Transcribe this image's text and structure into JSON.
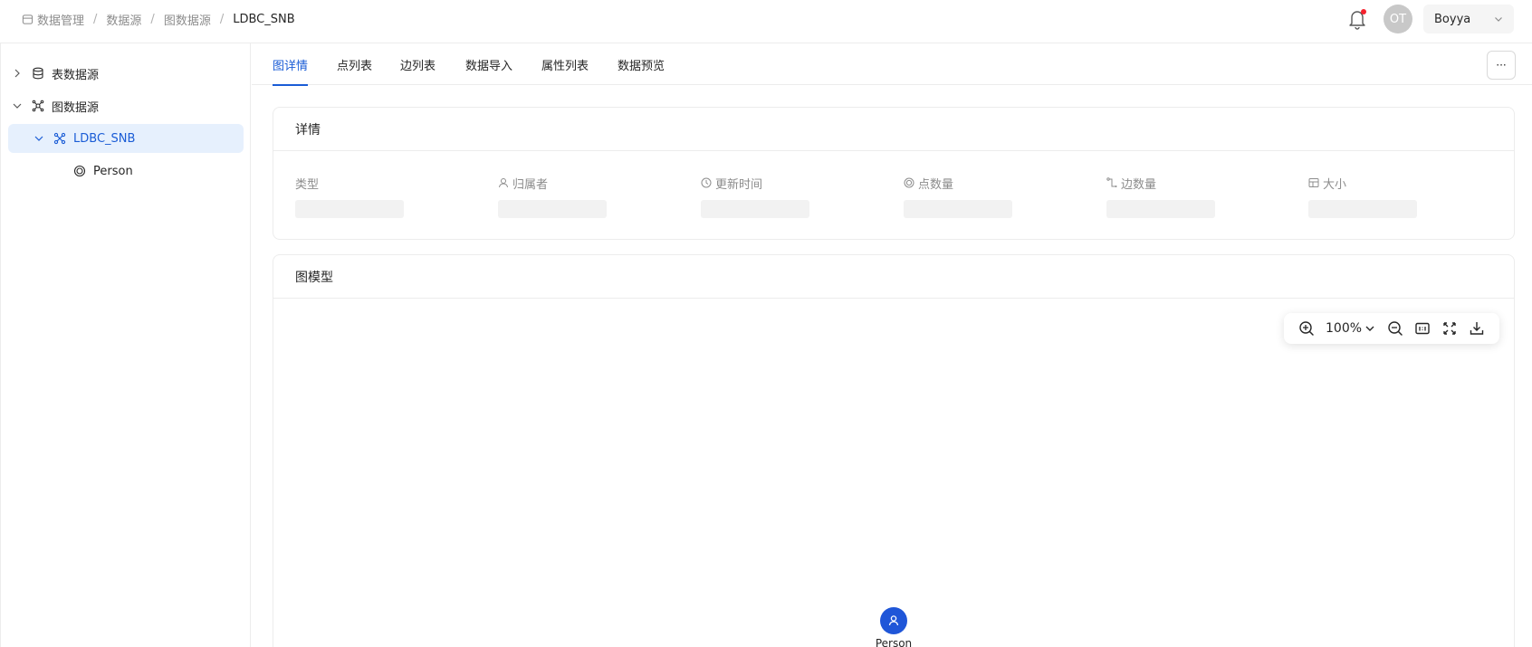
{
  "breadcrumb": [
    "数据管理",
    "数据源",
    "图数据源",
    "LDBC_SNB"
  ],
  "header": {
    "avatar_initials": "OT",
    "user_name": "Boyya"
  },
  "sidebar": {
    "items": [
      {
        "label": "表数据源",
        "expanded": false
      },
      {
        "label": "图数据源",
        "expanded": true
      },
      {
        "label": "LDBC_SNB",
        "expanded": true,
        "selected": true
      },
      {
        "label": "Person"
      }
    ]
  },
  "tabs": [
    "图详情",
    "点列表",
    "边列表",
    "数据导入",
    "属性列表",
    "数据预览"
  ],
  "active_tab": "图详情",
  "more_label": "···",
  "details": {
    "title": "详情",
    "fields": [
      "类型",
      "归属者",
      "更新时间",
      "点数量",
      "边数量",
      "大小"
    ]
  },
  "graph_model": {
    "title": "图模型",
    "zoom": "100%",
    "node_label": "Person"
  },
  "colors": {
    "accent": "#1a5cd6",
    "node": "#1f56d8",
    "selected_bg": "#e6f0fd",
    "notification_dot": "#f5222d"
  }
}
